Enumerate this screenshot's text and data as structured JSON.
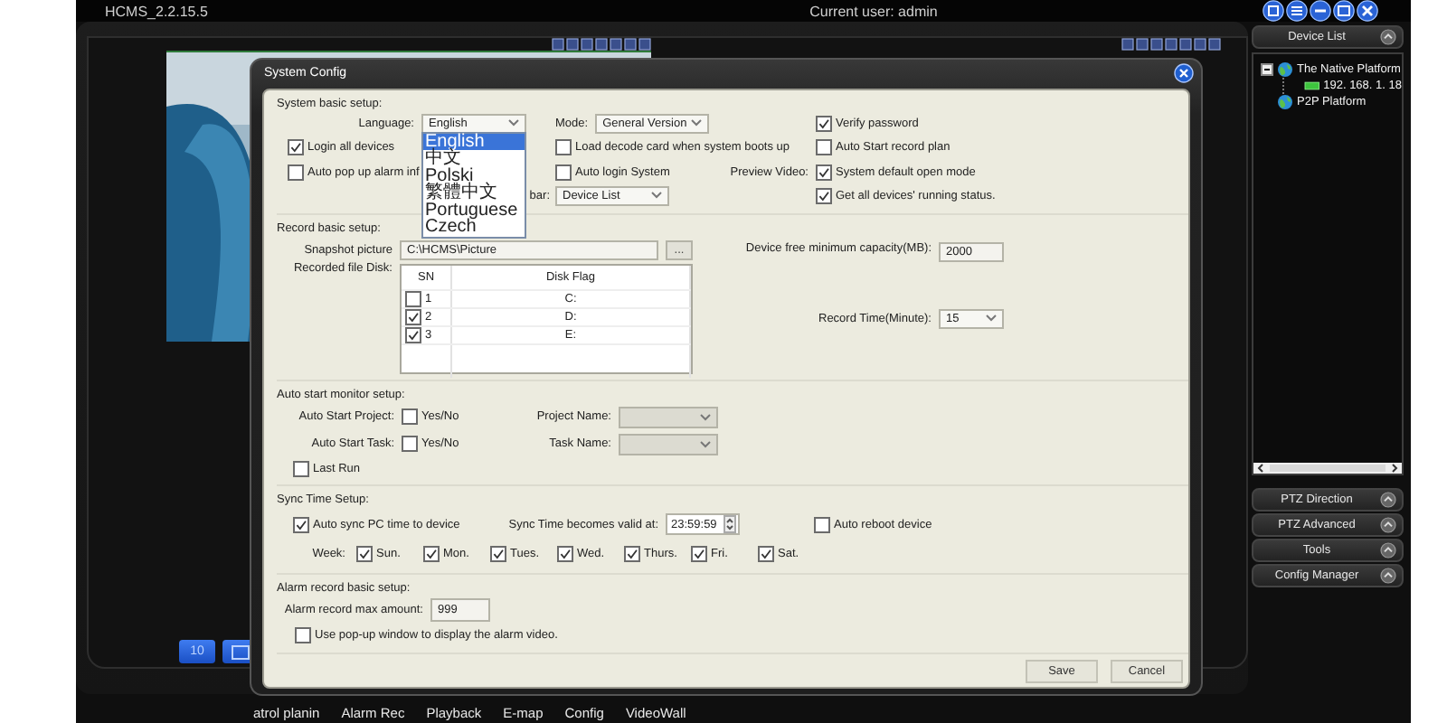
{
  "app": {
    "title": "HCMS_2.2.15.5",
    "user": "Current user: admin"
  },
  "view_buttons": {
    "split": "10"
  },
  "bottom_tabs": [
    {
      "label": "atrol planin"
    },
    {
      "label": "Alarm Rec"
    },
    {
      "label": "Playback"
    },
    {
      "label": "E-map"
    },
    {
      "label": "Config"
    },
    {
      "label": "VideoWall"
    }
  ],
  "sidebar": {
    "header": "Device List",
    "tree": [
      {
        "label": "The Native Platform",
        "kind": "platform",
        "expanded": true,
        "children": [
          {
            "label": "192. 168. 1. 18",
            "kind": "device"
          }
        ]
      },
      {
        "label": "P2P Platform",
        "kind": "platform"
      }
    ],
    "panels": [
      "PTZ Direction",
      "PTZ Advanced",
      "Tools",
      "Config Manager"
    ]
  },
  "dialog": {
    "title": "System Config",
    "sections": [
      {
        "kind": "basic",
        "heading": "System basic setup:",
        "rows": [
          [
            {
              "kind": "select",
              "label": "Language:",
              "value": "English",
              "expanded": true,
              "options": [
                {
                  "label": "English",
                  "selected": true
                },
                {
                  "label": "中文",
                  "selected": false
                },
                {
                  "label": "Polski",
                  "selected": false
                },
                {
                  "label": "繁體中文",
                  "selected": false
                },
                {
                  "label": "Portuguese",
                  "selected": false
                },
                {
                  "label": "Czech",
                  "selected": false
                }
              ]
            },
            {
              "kind": "select",
              "label": "Mode:",
              "value": "General Version"
            },
            {
              "kind": "checkbox",
              "label": "Verify password",
              "checked": true
            }
          ],
          [
            {
              "kind": "checkbox",
              "label": "Login all devices",
              "checked": true
            },
            {
              "kind": "checkbox",
              "label": "Load decode card when system boots up",
              "checked": false
            },
            {
              "kind": "checkbox",
              "label": "Auto Start record plan",
              "checked": false
            }
          ],
          [
            {
              "kind": "checkbox",
              "label": "Auto pop up alarm inf",
              "checked": false
            },
            {
              "kind": "checkbox",
              "label": "Auto login System",
              "checked": false
            },
            {
              "kind": "checkbox",
              "prefix": "Preview Video:",
              "label": "System default open mode",
              "checked": true
            }
          ],
          [
            {
              "kind": "text",
              "text": "bar:"
            },
            {
              "kind": "select",
              "value": "Device List"
            },
            {
              "kind": "checkbox",
              "label": "Get all devices' running status.",
              "checked": true
            }
          ]
        ]
      },
      {
        "kind": "record",
        "heading": "Record basic setup:",
        "rows": [
          [
            {
              "kind": "field",
              "label": "Snapshot picture",
              "value": "C:\\HCMS\\Picture",
              "button": "..."
            },
            {
              "kind": "field",
              "label": "Device free minimum capacity(MB):",
              "value": "2000"
            }
          ],
          [
            {
              "kind": "table",
              "label": "Recorded file Disk:",
              "columns": [
                "SN",
                "Disk Flag"
              ],
              "rows": [
                {
                  "sn": "1",
                  "flag": "C:",
                  "checked": false
                },
                {
                  "sn": "2",
                  "flag": "D:",
                  "checked": true
                },
                {
                  "sn": "3",
                  "flag": "E:",
                  "checked": true
                }
              ]
            },
            {
              "kind": "select",
              "label": "Record Time(Minute):",
              "value": "15"
            }
          ]
        ]
      },
      {
        "kind": "autostart",
        "heading": "Auto start monitor setup:",
        "rows": [
          [
            {
              "kind": "checkbox",
              "prefix": "Auto Start Project:",
              "label": "Yes/No",
              "checked": false
            },
            {
              "kind": "select",
              "label": "Project Name:",
              "disabled": true
            }
          ],
          [
            {
              "kind": "checkbox",
              "prefix": "Auto Start Task:",
              "label": "Yes/No",
              "checked": false
            },
            {
              "kind": "select",
              "label": "Task Name:",
              "disabled": true
            }
          ],
          [
            {
              "kind": "checkbox",
              "label": "Last Run",
              "checked": false
            }
          ]
        ]
      },
      {
        "kind": "sync",
        "heading": "Sync Time Setup:",
        "rows": [
          [
            {
              "kind": "checkbox",
              "label": "Auto sync PC time to device",
              "checked": true
            },
            {
              "kind": "spin",
              "label": "Sync Time becomes valid at:",
              "value": "23:59:59"
            },
            {
              "kind": "checkbox",
              "label": "Auto reboot device",
              "checked": false
            }
          ],
          [
            {
              "kind": "week",
              "label": "Week:",
              "days": [
                {
                  "label": "Sun.",
                  "checked": true
                },
                {
                  "label": "Mon.",
                  "checked": true
                },
                {
                  "label": "Tues.",
                  "checked": true
                },
                {
                  "label": "Wed.",
                  "checked": true
                },
                {
                  "label": "Thurs.",
                  "checked": true
                },
                {
                  "label": "Fri.",
                  "checked": true
                },
                {
                  "label": "Sat.",
                  "checked": true
                }
              ]
            }
          ]
        ]
      },
      {
        "kind": "alarm",
        "heading": "Alarm record basic setup:",
        "rows": [
          [
            {
              "kind": "field",
              "label": "Alarm record max amount:",
              "value": "999"
            }
          ],
          [
            {
              "kind": "checkbox",
              "label": "Use pop-up window to display the alarm video.",
              "checked": false
            }
          ]
        ]
      }
    ],
    "buttons": [
      "Save",
      "Cancel"
    ]
  }
}
